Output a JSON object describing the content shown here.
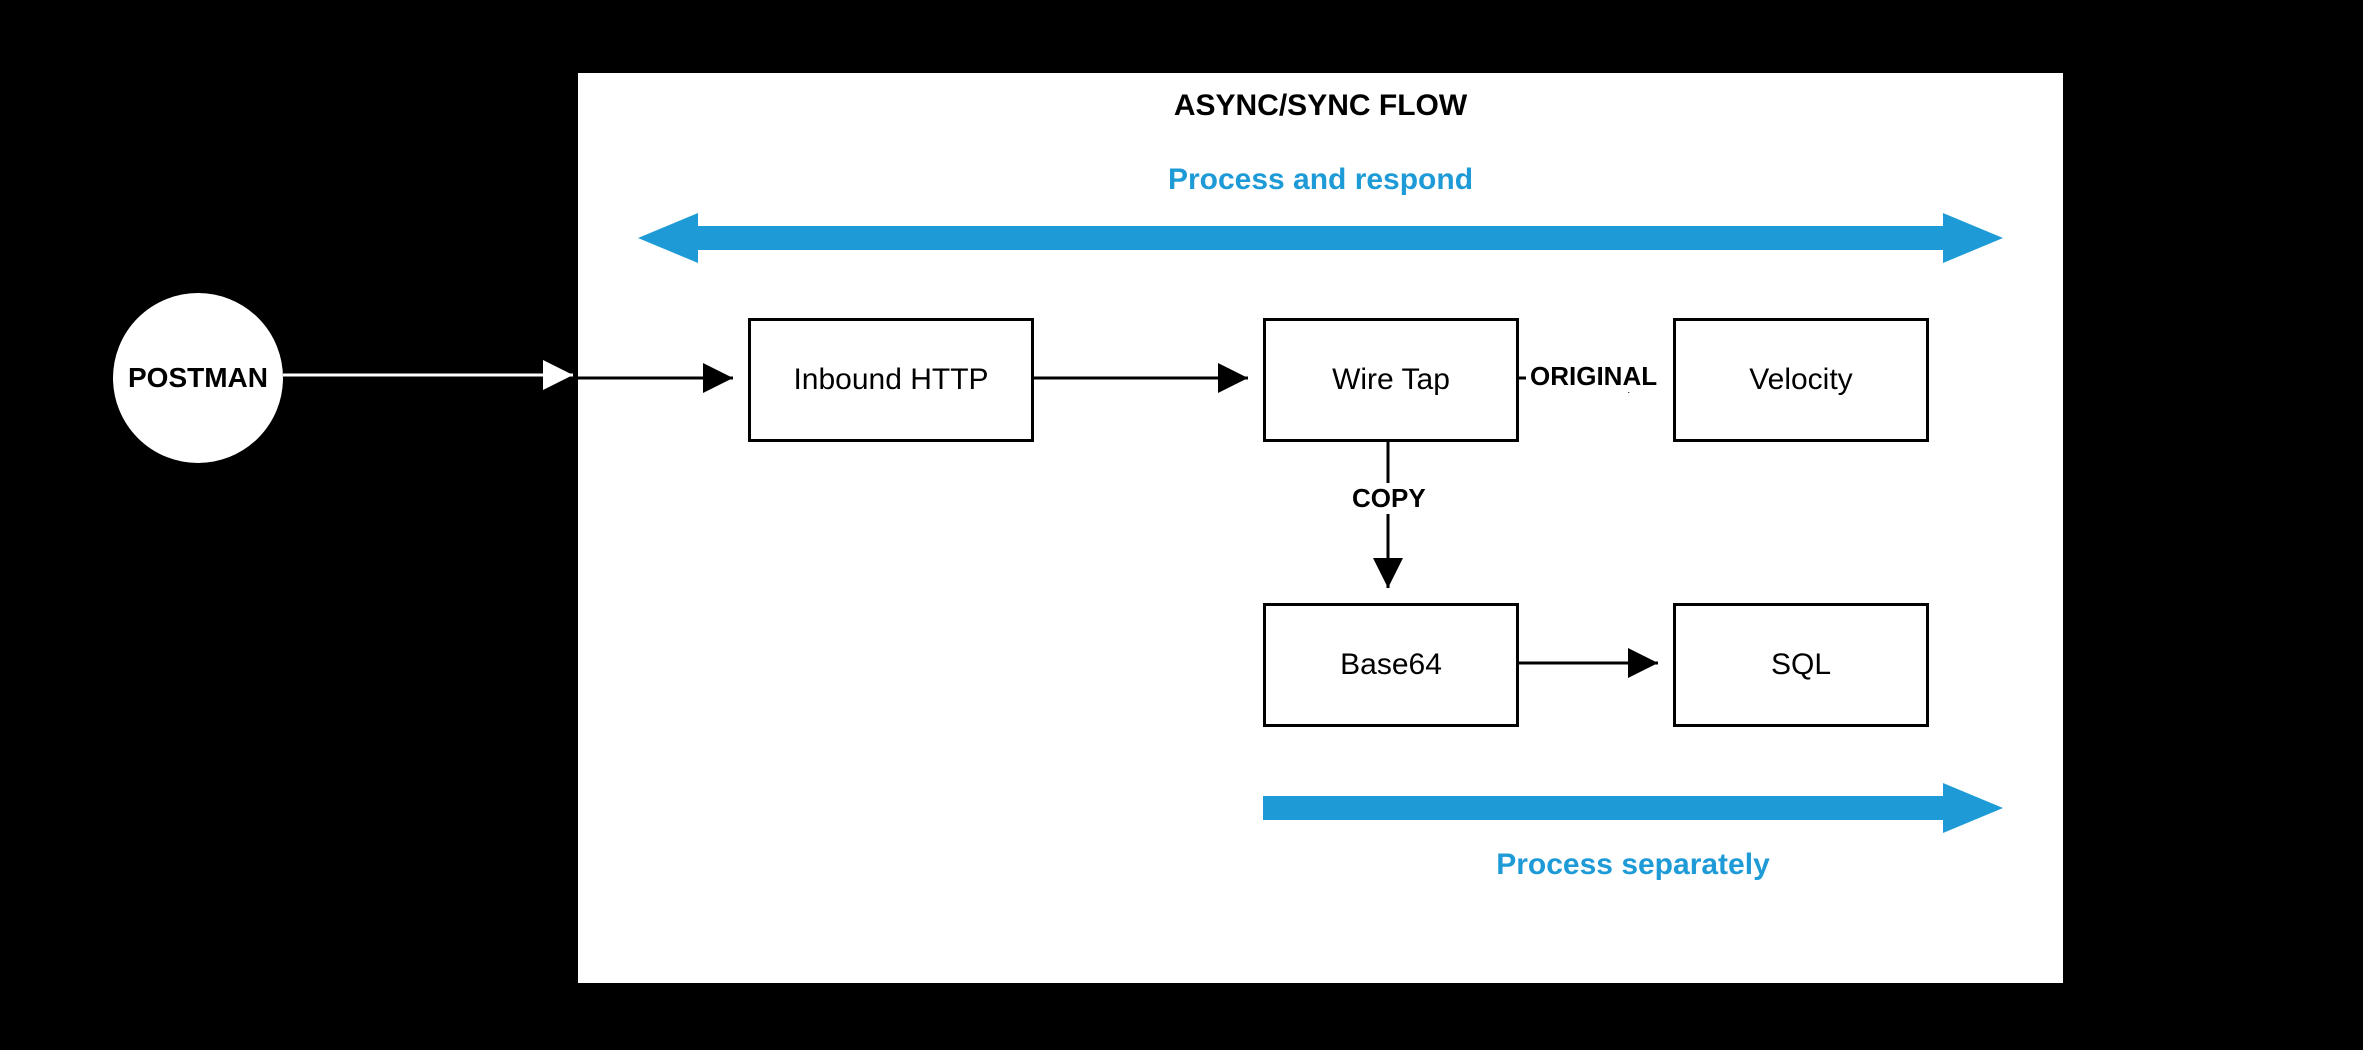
{
  "source": {
    "label": "POSTMAN"
  },
  "container": {
    "title": "ASYNC/SYNC FLOW"
  },
  "nodes": {
    "inbound": "Inbound HTTP",
    "wiretap": "Wire Tap",
    "velocity": "Velocity",
    "base64": "Base64",
    "sql": "SQL"
  },
  "edges": {
    "original": "ORIGINAL",
    "copy": "COPY"
  },
  "captions": {
    "top": "Process and respond",
    "bottom": "Process separately"
  },
  "colors": {
    "accent": "#1e9bd7",
    "fg": "#000000",
    "bg_outer": "#000000",
    "bg_inner": "#ffffff"
  }
}
